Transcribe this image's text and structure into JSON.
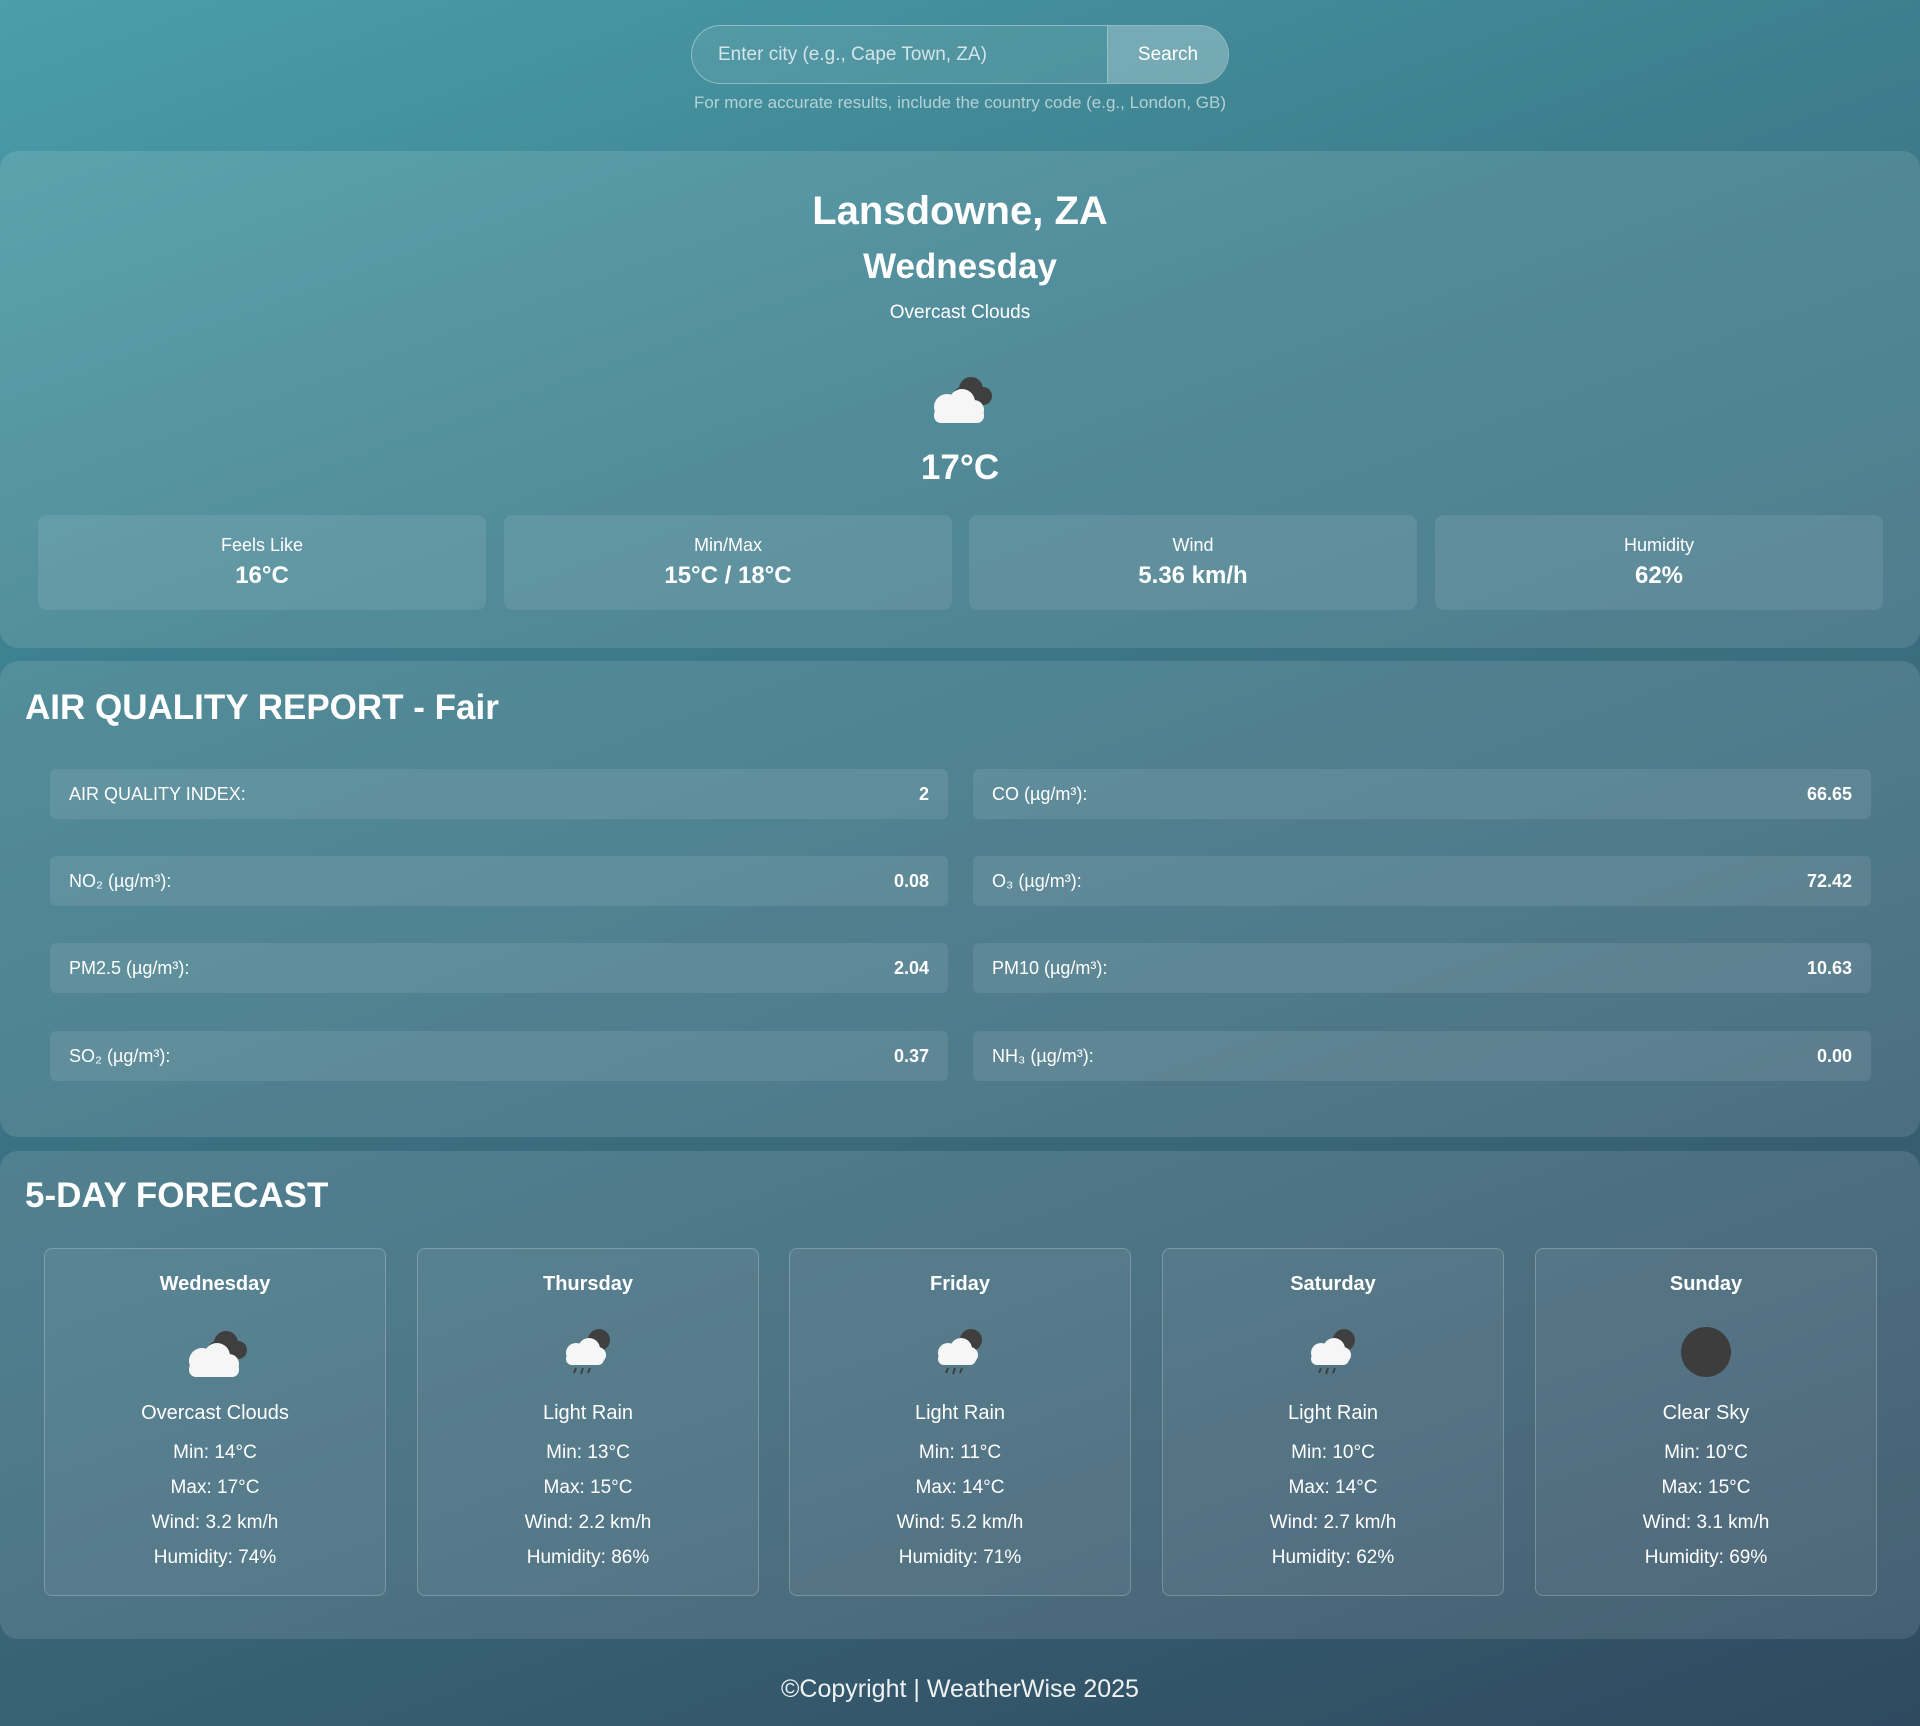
{
  "search": {
    "placeholder": "Enter city (e.g., Cape Town, ZA)",
    "button_label": "Search",
    "hint": "For more accurate results, include the country code (e.g., London, GB)"
  },
  "current": {
    "city": "Lansdowne, ZA",
    "day": "Wednesday",
    "description": "Overcast Clouds",
    "icon": "overcast-clouds-icon",
    "temperature": "17°C",
    "stats": [
      {
        "label": "Feels Like",
        "value": "16°C"
      },
      {
        "label": "Min/Max",
        "value": "15°C / 18°C"
      },
      {
        "label": "Wind",
        "value": "5.36 km/h"
      },
      {
        "label": "Humidity",
        "value": "62%"
      }
    ]
  },
  "air_quality": {
    "title": "AIR QUALITY REPORT - Fair",
    "rows": [
      {
        "label": "AIR QUALITY INDEX:",
        "value": "2"
      },
      {
        "label": "CO (µg/m³):",
        "value": "66.65"
      },
      {
        "label": "NO₂ (µg/m³):",
        "value": "0.08"
      },
      {
        "label": "O₃ (µg/m³):",
        "value": "72.42"
      },
      {
        "label": "PM2.5 (µg/m³):",
        "value": "2.04"
      },
      {
        "label": "PM10 (µg/m³):",
        "value": "10.63"
      },
      {
        "label": "SO₂ (µg/m³):",
        "value": "0.37"
      },
      {
        "label": "NH₃ (µg/m³):",
        "value": "0.00"
      }
    ]
  },
  "forecast": {
    "title": "5-DAY FORECAST",
    "days": [
      {
        "day": "Wednesday",
        "icon": "overcast-clouds-icon",
        "description": "Overcast Clouds",
        "min": "Min: 14°C",
        "max": "Max: 17°C",
        "wind": "Wind: 3.2 km/h",
        "humidity": "Humidity: 74%"
      },
      {
        "day": "Thursday",
        "icon": "light-rain-icon",
        "description": "Light Rain",
        "min": "Min: 13°C",
        "max": "Max: 15°C",
        "wind": "Wind: 2.2 km/h",
        "humidity": "Humidity: 86%"
      },
      {
        "day": "Friday",
        "icon": "light-rain-icon",
        "description": "Light Rain",
        "min": "Min: 11°C",
        "max": "Max: 14°C",
        "wind": "Wind: 5.2 km/h",
        "humidity": "Humidity: 71%"
      },
      {
        "day": "Saturday",
        "icon": "light-rain-icon",
        "description": "Light Rain",
        "min": "Min: 10°C",
        "max": "Max: 14°C",
        "wind": "Wind: 2.7 km/h",
        "humidity": "Humidity: 62%"
      },
      {
        "day": "Sunday",
        "icon": "clear-sky-icon",
        "description": "Clear Sky",
        "min": "Min: 10°C",
        "max": "Max: 15°C",
        "wind": "Wind: 3.1 km/h",
        "humidity": "Humidity: 69%"
      }
    ]
  },
  "footer": {
    "text": "©Copyright | WeatherWise 2025"
  }
}
